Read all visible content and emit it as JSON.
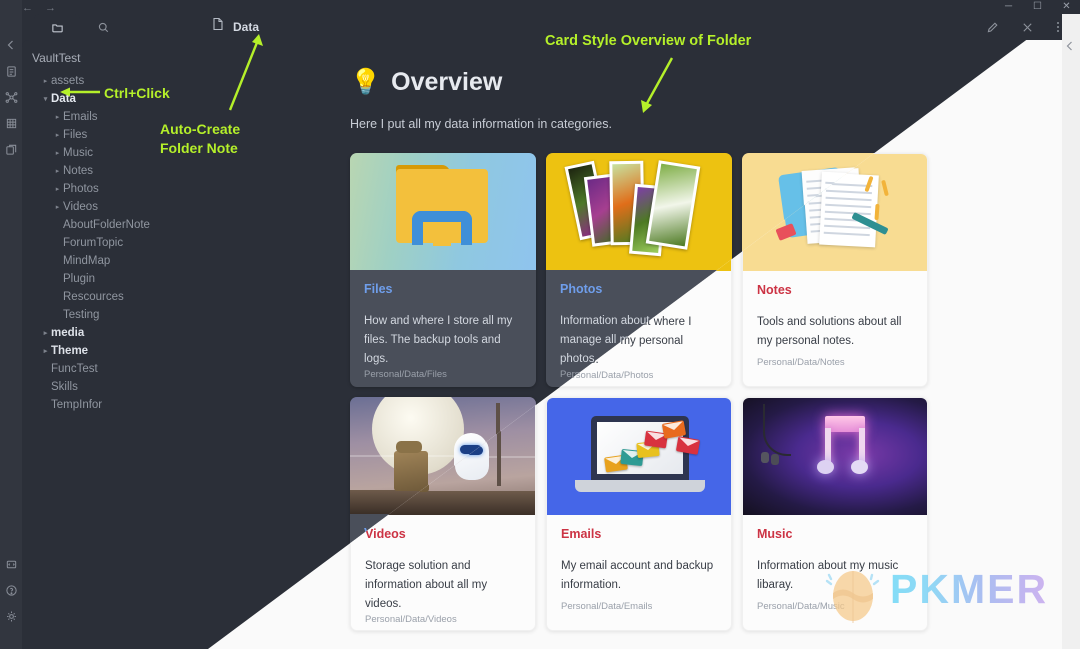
{
  "window": {
    "nav": {
      "back": "←",
      "forward": "→"
    },
    "controls": {
      "minimize": "─",
      "maximize": "☐",
      "close": "✕"
    }
  },
  "sidebar": {
    "tabs": [
      {
        "name": "file-explorer-tab",
        "icon": "folder-icon",
        "active": true
      },
      {
        "name": "search-tab",
        "icon": "search-icon",
        "active": false
      }
    ],
    "vault_name": "VaultTest",
    "items": [
      {
        "label": "assets",
        "depth": 0,
        "twisty": "▸",
        "bold": false
      },
      {
        "label": "Data",
        "depth": 0,
        "twisty": "▾",
        "bold": true
      },
      {
        "label": "Emails",
        "depth": 1,
        "twisty": "▸",
        "bold": false
      },
      {
        "label": "Files",
        "depth": 1,
        "twisty": "▸",
        "bold": false
      },
      {
        "label": "Music",
        "depth": 1,
        "twisty": "▸",
        "bold": false
      },
      {
        "label": "Notes",
        "depth": 1,
        "twisty": "▸",
        "bold": false
      },
      {
        "label": "Photos",
        "depth": 1,
        "twisty": "▸",
        "bold": false
      },
      {
        "label": "Videos",
        "depth": 1,
        "twisty": "▸",
        "bold": false
      },
      {
        "label": "AboutFolderNote",
        "depth": 1,
        "twisty": "",
        "bold": false
      },
      {
        "label": "ForumTopic",
        "depth": 1,
        "twisty": "",
        "bold": false
      },
      {
        "label": "MindMap",
        "depth": 1,
        "twisty": "",
        "bold": false
      },
      {
        "label": "Plugin",
        "depth": 1,
        "twisty": "",
        "bold": false
      },
      {
        "label": "Rescources",
        "depth": 1,
        "twisty": "",
        "bold": false
      },
      {
        "label": "Testing",
        "depth": 1,
        "twisty": "",
        "bold": false
      },
      {
        "label": "media",
        "depth": 0,
        "twisty": "▸",
        "bold": true
      },
      {
        "label": "Theme",
        "depth": 0,
        "twisty": "▸",
        "bold": true
      },
      {
        "label": "FuncTest",
        "depth": 0,
        "twisty": "",
        "bold": false
      },
      {
        "label": "Skills",
        "depth": 0,
        "twisty": "",
        "bold": false
      },
      {
        "label": "TempInfor",
        "depth": 0,
        "twisty": "",
        "bold": false
      }
    ]
  },
  "rail": {
    "top_icons": [
      "collapse-left-icon",
      "file-note-icon",
      "graph-view-icon",
      "canvas-grid-icon",
      "cards-icon"
    ],
    "bottom_icons": [
      "terminal-icon",
      "help-icon",
      "settings-gear-icon"
    ]
  },
  "document": {
    "tab_label": "Data",
    "tab_icon": "file-icon",
    "tools": [
      "edit-pencil-icon",
      "close-icon",
      "more-options-icon"
    ]
  },
  "note": {
    "emoji": "💡",
    "heading": "Overview",
    "subtitle": "Here I put all my data information in categories."
  },
  "annotations": [
    {
      "name": "ctrl-click-annotation",
      "text": "Ctrl+Click"
    },
    {
      "name": "auto-create-annotation",
      "text": "Auto-Create\nFolder Note"
    },
    {
      "name": "card-style-annotation",
      "text": "Card Style Overview of Folder"
    }
  ],
  "cards": [
    {
      "title": "Files",
      "description": "How and where I store all my files. The backup tools and logs.",
      "path": "Personal/Data/Files",
      "thumb": "windows-explorer-folder-image",
      "thumb_class": "th-files"
    },
    {
      "title": "Photos",
      "description": "Information about where I manage all my personal photos.",
      "path": "Personal/Data/Photos",
      "thumb": "photo-stack-flowers-image",
      "thumb_class": "th-photos"
    },
    {
      "title": "Notes",
      "description": "Tools and solutions about all my personal notes.",
      "path": "Personal/Data/Notes",
      "thumb": "notepaper-pen-image",
      "thumb_class": "th-notes"
    },
    {
      "title": "Videos",
      "description": "Storage solution and information about all my videos.",
      "path": "Personal/Data/Videos",
      "thumb": "walle-eve-moon-image",
      "thumb_class": "th-videos"
    },
    {
      "title": "Emails",
      "description": "My email account and backup information.",
      "path": "Personal/Data/Emails",
      "thumb": "laptop-envelopes-image",
      "thumb_class": "th-emails"
    },
    {
      "title": "Music",
      "description": "Information about my music libaray.",
      "path": "Personal/Data/Music",
      "thumb": "neon-music-note-earphones-image",
      "thumb_class": "th-music"
    }
  ],
  "watermark": {
    "text": "PKMER",
    "logo": "pkmer-egg-logo"
  },
  "colors": {
    "dark_bg": "#2b2f38",
    "dark_card": "#4a4f5a",
    "light_bg": "#fafafa",
    "light_card": "#fcfcfc",
    "annotation_green": "#b5f02a",
    "dark_title_blue": "#6f9eeb",
    "light_title_red": "#cc3344"
  }
}
